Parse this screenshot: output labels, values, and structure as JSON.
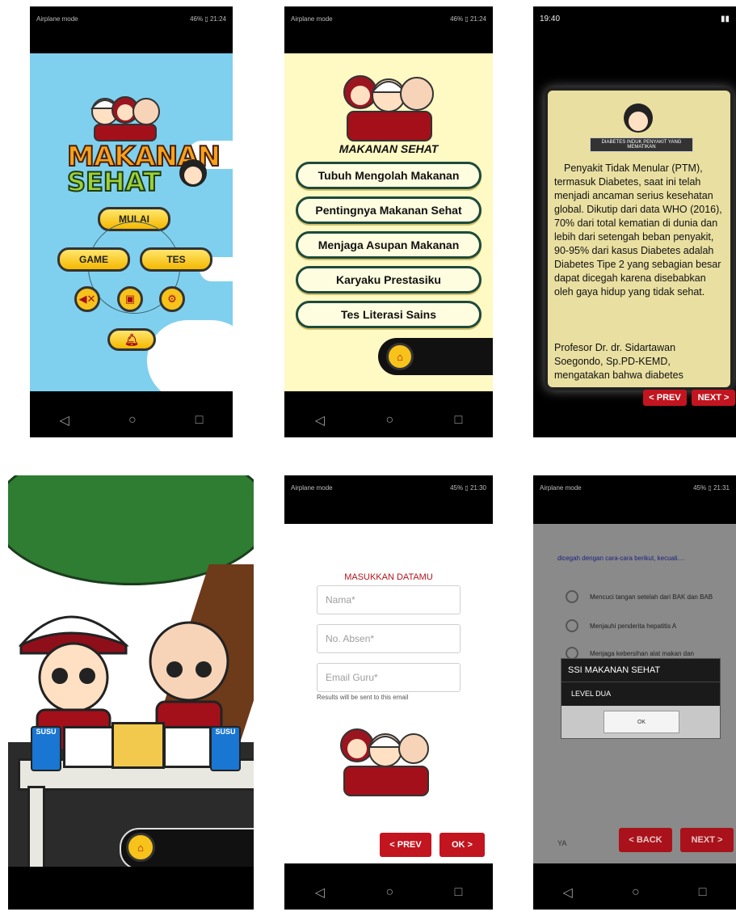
{
  "screen1": {
    "status_left": "Airplane mode",
    "status_right": "46% ▯ 21:24",
    "logo_line1": "MAKANAN",
    "logo_line2": "SEHAT",
    "mulai": "MULAI",
    "game": "GAME",
    "tes": "TES"
  },
  "screen2": {
    "status_left": "Airplane mode",
    "status_right": "46% ▯ 21:24",
    "title": "MAKANAN SEHAT",
    "menu": [
      "Tubuh Mengolah Makanan",
      "Pentingnya Makanan Sehat",
      "Menjaga Asupan Makanan",
      "Karyaku Prestasiku",
      "Tes Literasi Sains"
    ]
  },
  "screen3": {
    "status_time": "19:40",
    "badge": "DIABETES INDUK PENYAKIT YANG MEMATIKAN",
    "paragraph1": "Penyakit Tidak Menular (PTM), termasuk Diabetes, saat ini telah menjadi ancaman serius kesehatan global. Dikutip dari data WHO (2016), 70% dari total kematian di dunia dan lebih dari setengah beban penyakit, 90-95% dari kasus Diabetes adalah Diabetes Tipe 2 yang sebagian besar dapat dicegah karena disebabkan oleh gaya hidup yang tidak sehat.",
    "paragraph2": "Profesor Dr. dr. Sidartawan Soegondo, Sp.PD-KEMD, mengatakan bahwa diabetes",
    "prev": "< PREV",
    "next": "NEXT >"
  },
  "screen4": {
    "can_label": "SUSU"
  },
  "screen5": {
    "status_left": "Airplane mode",
    "status_right": "45% ▯ 21:30",
    "title": "MASUKKAN DATAMU",
    "nama_placeholder": "Nama*",
    "absen_placeholder": "No. Absen*",
    "email_placeholder": "Email Guru*",
    "hint": "Results will be sent to this email",
    "prev": "< PREV",
    "ok": "OK >"
  },
  "screen6": {
    "status_left": "Airplane mode",
    "status_right": "45% ▯ 21:31",
    "question": "dicegah dengan cara-cara berikut, kecuali....",
    "options": [
      "Mencuci tangan setelah dari BAK dan BAB",
      "Menjauhi penderita hepatitis A",
      "Menjaga kebersihan alat makan dan"
    ],
    "dialog_title": "SSI MAKANAN SEHAT",
    "dialog_message": "LEVEL DUA",
    "dialog_ok": "OK",
    "ya": "YA",
    "back": "< BACK",
    "next": "NEXT >"
  },
  "colors": {
    "accent_red": "#c2151f",
    "sky_blue": "#7fd0ee",
    "cream": "#fff9c4",
    "gold": "#f7c21a"
  }
}
